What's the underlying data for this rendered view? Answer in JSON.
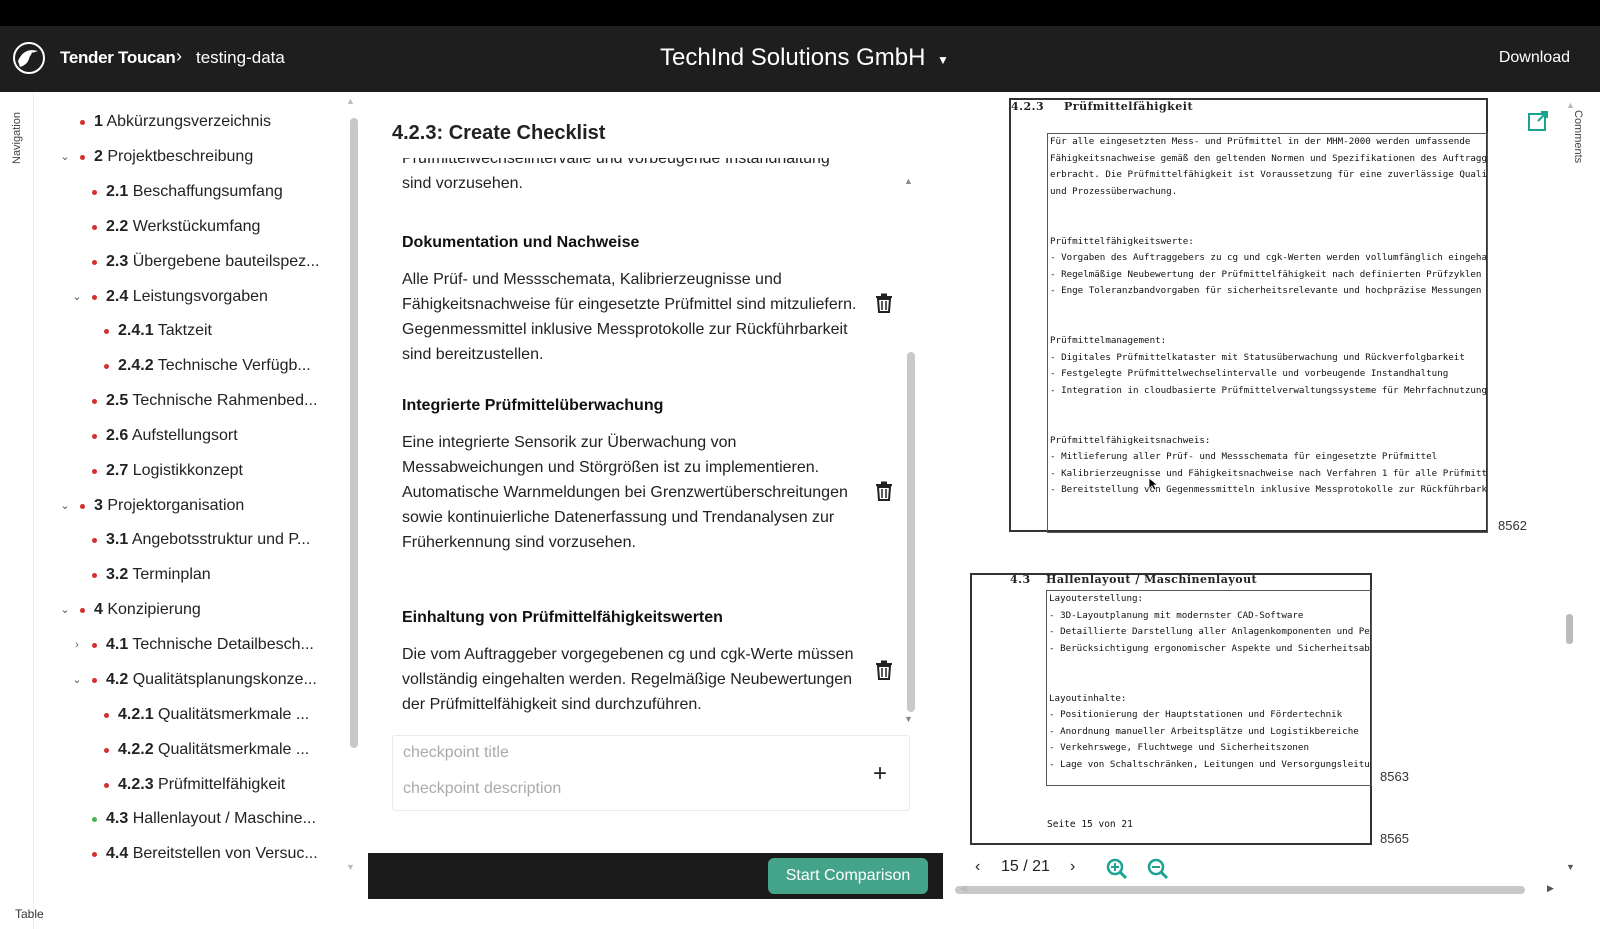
{
  "header": {
    "brand": "Tender Toucan",
    "crumb": "testing-data",
    "company": "TechInd Solutions GmbH",
    "download_label": "Download"
  },
  "rail": {
    "navigation_label": "Navigation",
    "table_label": "Table",
    "comments_label": "Comments"
  },
  "nav": {
    "items": [
      {
        "num": "1",
        "label": "Abkürzungsverzeichnis"
      },
      {
        "num": "2",
        "label": "Projektbeschreibung"
      },
      {
        "num": "2.1",
        "label": "Beschaffungsumfang"
      },
      {
        "num": "2.2",
        "label": "Werkstückumfang"
      },
      {
        "num": "2.3",
        "label": "Übergebene bauteilspez..."
      },
      {
        "num": "2.4",
        "label": "Leistungsvorgaben"
      },
      {
        "num": "2.4.1",
        "label": "Taktzeit"
      },
      {
        "num": "2.4.2",
        "label": "Technische Verfügb..."
      },
      {
        "num": "2.5",
        "label": "Technische Rahmenbed..."
      },
      {
        "num": "2.6",
        "label": "Aufstellungsort"
      },
      {
        "num": "2.7",
        "label": "Logistikkonzept"
      },
      {
        "num": "3",
        "label": "Projektorganisation"
      },
      {
        "num": "3.1",
        "label": "Angebotsstruktur und P..."
      },
      {
        "num": "3.2",
        "label": "Terminplan"
      },
      {
        "num": "4",
        "label": "Konzipierung"
      },
      {
        "num": "4.1",
        "label": "Technische Detailbesch..."
      },
      {
        "num": "4.2",
        "label": "Qualitätsplanungskonze..."
      },
      {
        "num": "4.2.1",
        "label": "Qualitätsmerkmale ..."
      },
      {
        "num": "4.2.2",
        "label": "Qualitätsmerkmale ..."
      },
      {
        "num": "4.2.3",
        "label": "Prüfmittelfähigkeit"
      },
      {
        "num": "4.3",
        "label": "Hallenlayout / Maschine..."
      },
      {
        "num": "4.4",
        "label": "Bereitstellen von Versuc..."
      }
    ]
  },
  "checklist": {
    "title_num": "4.2.3:",
    "title": "Create Checklist",
    "cut_text": "Prüfmittelwechselintervalle und vorbeugende Instandhaltung sind vorzusehen.",
    "items": [
      {
        "title": "Dokumentation und Nachweise",
        "desc": "Alle Prüf- und Messschemata, Kalibrierzeugnisse und Fähigkeitsnachweise für eingesetzte Prüfmittel sind mitzuliefern. Gegenmessmittel inklusive Messprotokolle zur Rückführbarkeit sind bereitzustellen."
      },
      {
        "title": "Integrierte Prüfmittelüberwachung",
        "desc": "Eine integrierte Sensorik zur Überwachung von Messabweichungen und Störgrößen ist zu implementieren. Automatische Warnmeldungen bei Grenzwertüberschreitungen sowie kontinuierliche Datenerfassung und Trendanalysen zur Früherkennung sind vorzusehen."
      },
      {
        "title": "Einhaltung von Prüfmittelfähigkeitswerten",
        "desc": "Die vom Auftraggeber vorgegebenen cg und cgk-Werte müssen vollständig eingehalten werden. Regelmäßige Neubewertungen der Prüfmittelfähigkeit sind durchzuführen."
      }
    ],
    "title_placeholder": "checkpoint title",
    "desc_placeholder": "checkpoint description",
    "start_label": "Start Comparison"
  },
  "pdf": {
    "page1": {
      "head_num": "4.2.3",
      "head_title": "Prüfmittelfähigkeit",
      "body": "Für alle eingesetzten Mess- und Prüfmittel in der MHM-2000 werden umfassende\nFähigkeitsnachweise gemäß den geltenden Normen und Spezifikationen des Auftraggebers\nerbracht. Die Prüfmittelfähigkeit ist Voraussetzung für eine zuverlässige Qualitätssicherung\nund Prozessüberwachung.\n\n\nPrüfmittelfähigkeitswerte:\n- Vorgaben des Auftraggebers zu cg und cgk-Werten werden vollumfänglich eingehalten\n- Regelmäßige Neubewertung der Prüfmittelfähigkeit nach definierten Prüfzyklen\n- Enge Toleranzbandvorgaben für sicherheitsrelevante und hochpräzise Messungen\n\n\nPrüfmittelmanagement:\n- Digitales Prüfmittelkataster mit Statusüberwachung und Rückverfolgbarkeit\n- Festgelegte Prüfmittelwechselintervalle und vorbeugende Instandhaltung\n- Integration in cloudbasierte Prüfmittelverwaltungssysteme für Mehrfachnutzung\n\n\nPrüfmittelfähigkeitsnachweis:\n- Mitlieferung aller Prüf- und Messschemata für eingesetzte Prüfmittel\n- Kalibrierzeugnisse und Fähigkeitsnachweise nach Verfahren 1 für alle Prüfmittel\n- Bereitstellung von Gegenmessmitteln inklusive Messprotokolle zur Rückführbarkeit\n\n\nPrüfmittelüberwachung:\n- Integrierte Sensorik zur Überwachung von Messabweichungen und Störgrößen\n\n\n- Automatische Warnmeldungen bei Grenzwertüberschreitungen\n- Kontinuierliche Datenerfassung und Trendanalysen zur Früherkennung",
      "line_num": "8562"
    },
    "page2": {
      "head_num": "4.3",
      "head_title": "Hallenlayout / Maschinenlayout",
      "body": "Layouterstellung:\n- 3D-Layoutplanung mit modernster CAD-Software\n- Detaillierte Darstellung aller Anlagenkomponenten und Peripherie\n- Berücksichtigung ergonomischer Aspekte und Sicherheitsabstände\n\n\nLayoutinhalte:\n- Positionierung der Hauptstationen und Fördertechnik\n- Anordnung manueller Arbeitsplätze und Logistikbereiche\n- Verkehrswege, Fluchtwege und Sicherheitszonen\n- Lage von Schaltschränken, Leitungen und Versorgungsleitungen\n\n\nLayoutoptimierung:",
      "line_num_a": "8563",
      "footer": "Seite 15 von 21",
      "line_num_b": "8565"
    },
    "page_indicator": "15 / 21"
  },
  "colors": {
    "header_bg": "#1e1e1e",
    "accent_green": "#44a48a",
    "dot_red": "#d32f2f",
    "dot_green": "#4caf50",
    "link_teal": "#1aa390"
  }
}
